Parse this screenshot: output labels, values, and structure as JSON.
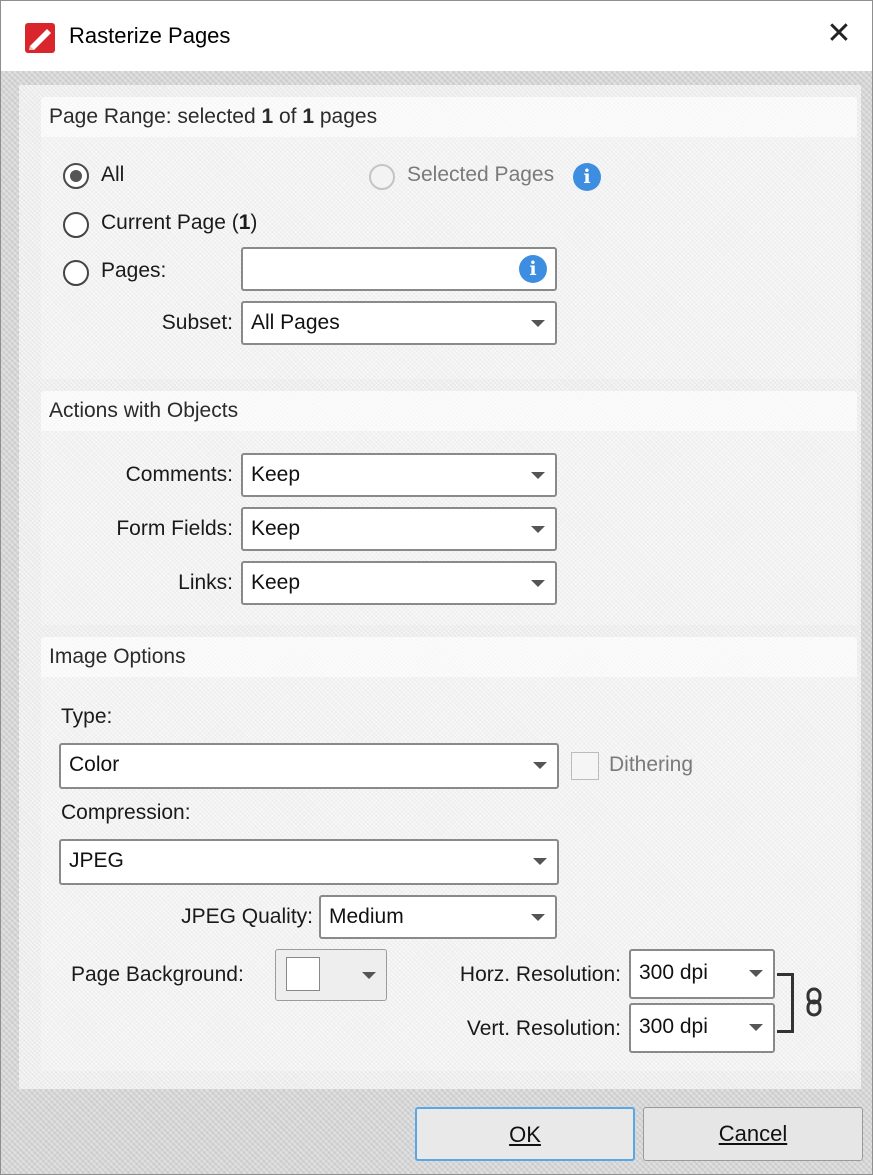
{
  "window": {
    "title": "Rasterize Pages",
    "close_label": "✕"
  },
  "page_range": {
    "header_prefix": "Page Range: selected ",
    "selected_count": "1",
    "header_of": " of ",
    "total_count": "1",
    "header_suffix": " pages",
    "all_label": "All",
    "selected_pages_label": "Selected Pages",
    "current_page_label": "Current Page (",
    "current_page_number": "1",
    "current_page_close": ")",
    "pages_label": "Pages:",
    "pages_value": "",
    "subset_label": "Subset:",
    "subset_value": "All Pages"
  },
  "actions": {
    "header": "Actions with Objects",
    "comments_label": "Comments:",
    "comments_value": "Keep",
    "form_fields_label": "Form Fields:",
    "form_fields_value": "Keep",
    "links_label": "Links:",
    "links_value": "Keep"
  },
  "image_options": {
    "header": "Image Options",
    "type_label": "Type:",
    "type_value": "Color",
    "dithering_label": "Dithering",
    "compression_label": "Compression:",
    "compression_value": "JPEG",
    "jpeg_quality_label": "JPEG Quality:",
    "jpeg_quality_value": "Medium",
    "page_background_label": "Page Background:",
    "page_background_color": "#ffffff",
    "horz_resolution_label": "Horz. Resolution:",
    "horz_resolution_value": "300 dpi",
    "vert_resolution_label": "Vert. Resolution:",
    "vert_resolution_value": "300 dpi"
  },
  "buttons": {
    "ok_label": "OK",
    "cancel_label": "Cancel"
  },
  "colors": {
    "info_blue": "#3d8ee0",
    "default_button_border": "#5aa7e6",
    "app_icon_red": "#d9262c"
  }
}
